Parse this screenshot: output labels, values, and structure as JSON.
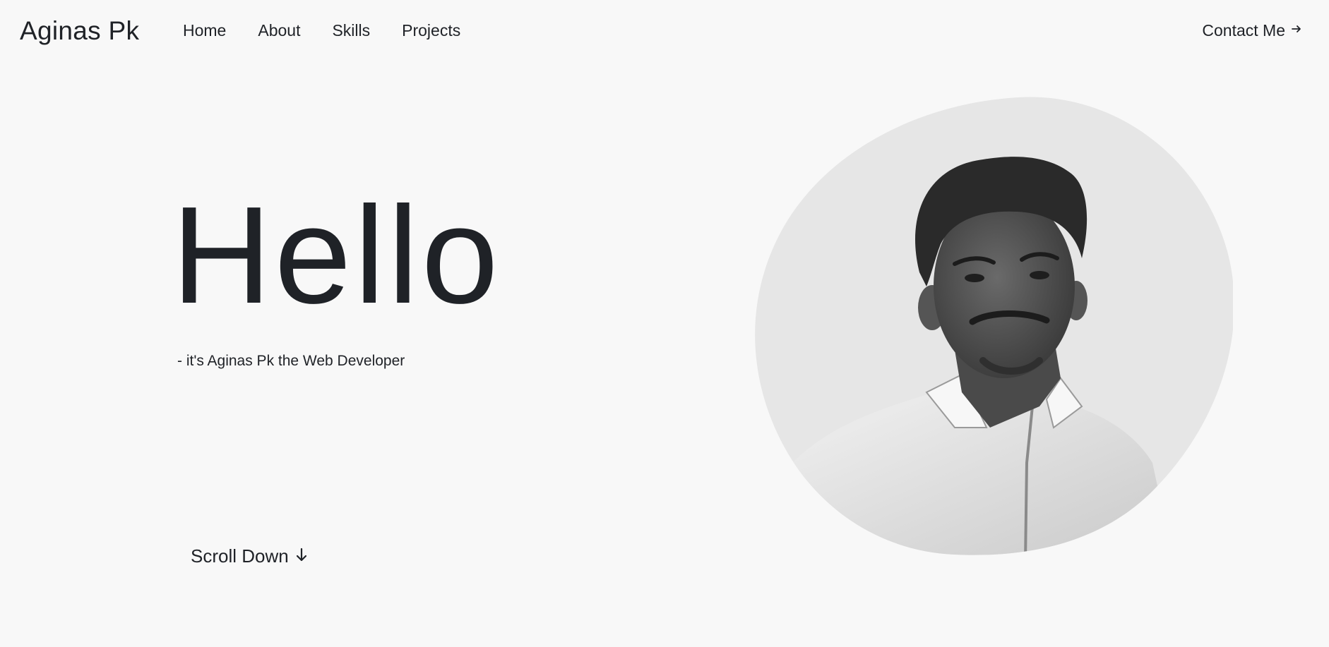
{
  "header": {
    "logo": "Aginas Pk",
    "nav": [
      {
        "label": "Home"
      },
      {
        "label": "About"
      },
      {
        "label": "Skills"
      },
      {
        "label": "Projects"
      }
    ],
    "contact_label": "Contact Me",
    "contact_icon": "arrow-right-icon"
  },
  "hero": {
    "title": "Hello",
    "tagline": "- it's Aginas Pk the Web Developer",
    "scroll_label": "Scroll Down",
    "scroll_icon": "arrow-down-icon"
  },
  "portrait": {
    "description_icon": "profile-photo"
  },
  "colors": {
    "background": "#f8f8f8",
    "text": "#1f2227",
    "blob": "#e6e6e6"
  }
}
